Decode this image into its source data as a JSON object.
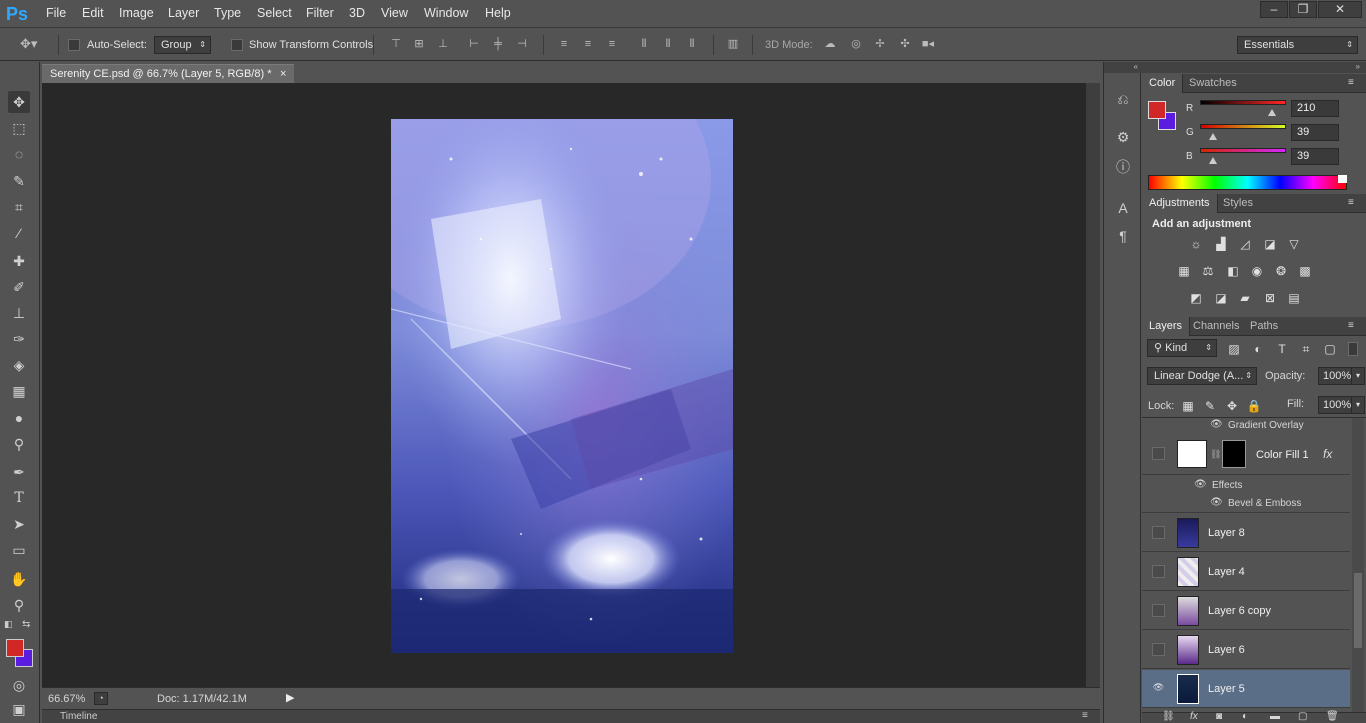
{
  "app": {
    "logo": "Ps"
  },
  "menu": [
    "File",
    "Edit",
    "Image",
    "Layer",
    "Type",
    "Select",
    "Filter",
    "3D",
    "View",
    "Window",
    "Help"
  ],
  "window_controls": [
    "–",
    "❐",
    "✕"
  ],
  "options": {
    "auto_select_label": "Auto-Select:",
    "auto_select_value": "Group",
    "show_transform": "Show Transform Controls",
    "mode_3d": "3D Mode:",
    "workspace": "Essentials"
  },
  "document": {
    "tab_title": "Serenity CE.psd @ 66.7% (Layer 5, RGB/8) *",
    "close": "×",
    "zoom": "66.67%",
    "doc_size": "Doc: 1.17M/42.1M"
  },
  "timeline": {
    "label": "Timeline"
  },
  "color_panel": {
    "tabs": [
      "Color",
      "Swatches"
    ],
    "channels": [
      {
        "label": "R",
        "value": "210",
        "pos": 0.82
      },
      {
        "label": "G",
        "value": "39",
        "pos": 0.15
      },
      {
        "label": "B",
        "value": "39",
        "pos": 0.15
      }
    ],
    "fg": "#d22727",
    "bg": "#5a1de0"
  },
  "adjustments": {
    "tabs": [
      "Adjustments",
      "Styles"
    ],
    "heading": "Add an adjustment"
  },
  "layers_panel": {
    "tabs": [
      "Layers",
      "Channels",
      "Paths"
    ],
    "kind": "Kind",
    "blend_mode": "Linear Dodge (A...",
    "opacity_label": "Opacity:",
    "opacity": "100%",
    "lock_label": "Lock:",
    "fill_label": "Fill:",
    "fill": "100%",
    "effect_gradient": "Gradient Overlay",
    "color_fill": "Color Fill 1",
    "fx": "fx",
    "effects": "Effects",
    "bevel": "Bevel & Emboss",
    "layers": [
      "Layer 8",
      "Layer 4",
      "Layer 6 copy",
      "Layer 6",
      "Layer 5"
    ]
  }
}
